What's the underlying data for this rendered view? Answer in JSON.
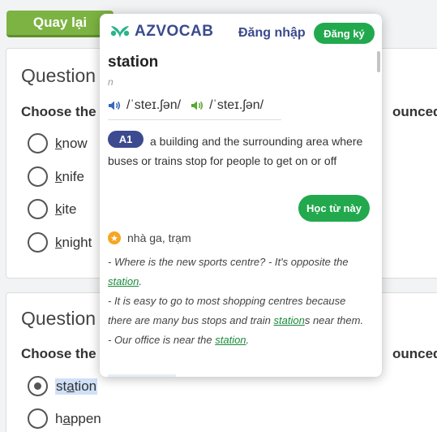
{
  "back_button": {
    "label": "Quay lại"
  },
  "question1": {
    "title": "Question",
    "instruction": "Choose the",
    "instruction_end": "ounced",
    "options": [
      {
        "before": "",
        "underlined": "k",
        "after": "now"
      },
      {
        "before": "",
        "underlined": "k",
        "after": "nife"
      },
      {
        "before": "",
        "underlined": "k",
        "after": "ite"
      },
      {
        "before": "",
        "underlined": "k",
        "after": "night"
      }
    ]
  },
  "question2": {
    "title": "Question",
    "instruction": "Choose the",
    "instruction_end": "ounced",
    "options": [
      {
        "before": "st",
        "underlined": "a",
        "after": "tion",
        "selected": true
      },
      {
        "before": "h",
        "underlined": "a",
        "after": "ppen",
        "selected": false
      }
    ]
  },
  "popup": {
    "logo": "AZVOCAB",
    "login": "Đăng nhập",
    "register": "Đăng ký",
    "word": "station",
    "part_of_speech": "n",
    "pronunciations": [
      "/ˈsteɪ.ʃən/",
      "/ˈsteɪ.ʃən/"
    ],
    "level": "A1",
    "definition": "a building and the surrounding area where buses or trains stop for people to get on or off",
    "learn_button": "Học từ này",
    "meaning": "nhà ga, trạm",
    "examples": [
      {
        "before": "- Where is the new sports centre? - It's opposite the ",
        "highlight": "station",
        "after": "."
      },
      {
        "before": "- It is easy to go to most shopping centres because there are many bus stops and train ",
        "highlight": "station",
        "after": "s near them."
      },
      {
        "before": "- Our office is near the ",
        "highlight": "station",
        "after": "."
      }
    ]
  },
  "colors": {
    "accent_green": "#22a94d",
    "brand_navy": "#3a4a8c",
    "back_green": "#7cb342"
  }
}
